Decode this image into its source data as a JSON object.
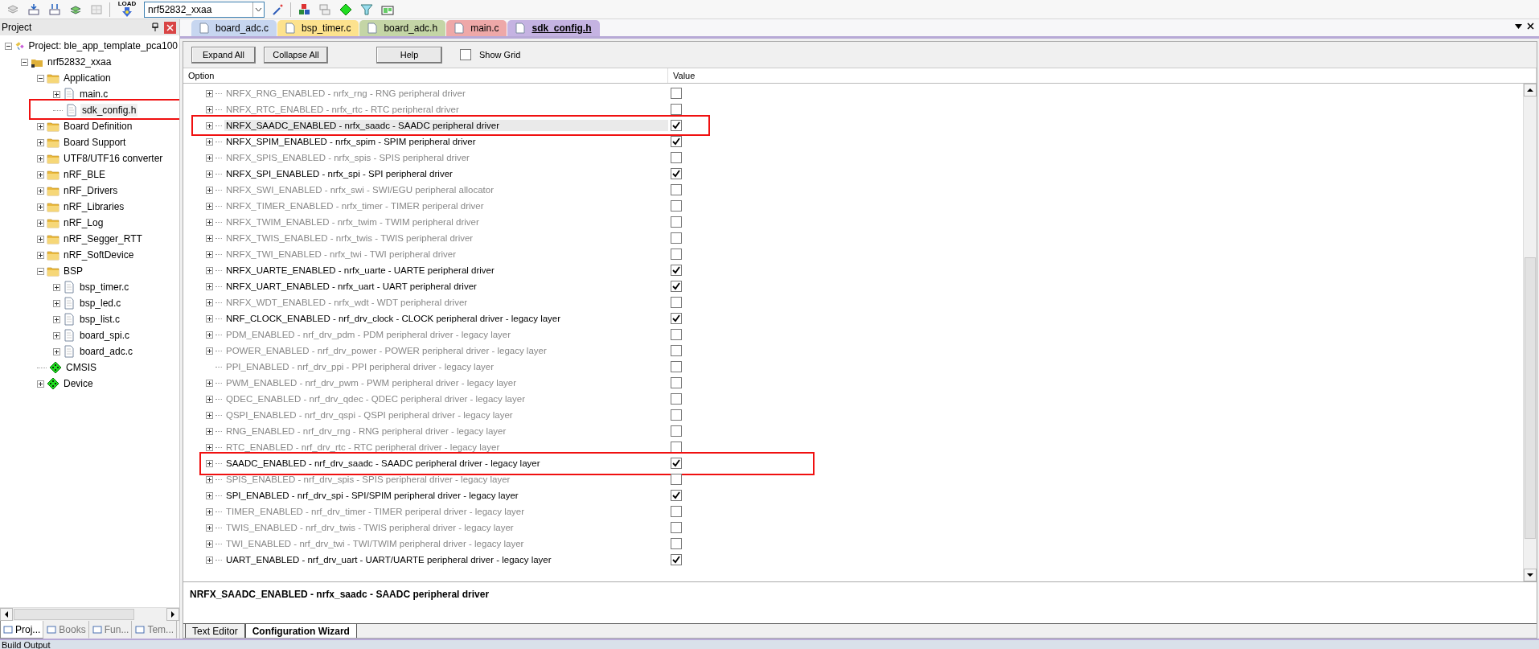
{
  "toolbar": {
    "load_label": "LOAD",
    "target": "nrf52832_xxaa"
  },
  "project_panel": {
    "title": "Project",
    "tree": [
      {
        "label": "Project: ble_app_template_pca100",
        "kind": "project",
        "expanded": true,
        "selected": false,
        "children": [
          {
            "label": "nrf52832_xxaa",
            "kind": "target",
            "expanded": true,
            "selected": false,
            "children": [
              {
                "label": "Application",
                "kind": "folder",
                "expanded": true,
                "selected": false,
                "children": [
                  {
                    "label": "main.c",
                    "kind": "file",
                    "expanded": false,
                    "selected": false
                  },
                  {
                    "label": "sdk_config.h",
                    "kind": "file",
                    "selected": true,
                    "highlighted": true
                  }
                ]
              },
              {
                "label": "Board Definition",
                "kind": "folder",
                "expanded": false,
                "selected": false
              },
              {
                "label": "Board Support",
                "kind": "folder",
                "expanded": false,
                "selected": false
              },
              {
                "label": "UTF8/UTF16 converter",
                "kind": "folder",
                "expanded": false,
                "selected": false
              },
              {
                "label": "nRF_BLE",
                "kind": "folder",
                "expanded": false,
                "selected": false
              },
              {
                "label": "nRF_Drivers",
                "kind": "folder",
                "expanded": false,
                "selected": false
              },
              {
                "label": "nRF_Libraries",
                "kind": "folder",
                "expanded": false,
                "selected": false
              },
              {
                "label": "nRF_Log",
                "kind": "folder",
                "expanded": false,
                "selected": false
              },
              {
                "label": "nRF_Segger_RTT",
                "kind": "folder",
                "expanded": false,
                "selected": false
              },
              {
                "label": "nRF_SoftDevice",
                "kind": "folder",
                "expanded": false,
                "selected": false
              },
              {
                "label": "BSP",
                "kind": "folder",
                "expanded": true,
                "selected": false,
                "children": [
                  {
                    "label": "bsp_timer.c",
                    "kind": "file",
                    "expanded": false,
                    "selected": false
                  },
                  {
                    "label": "bsp_led.c",
                    "kind": "file",
                    "expanded": false,
                    "selected": false
                  },
                  {
                    "label": "bsp_list.c",
                    "kind": "file",
                    "expanded": false,
                    "selected": false
                  },
                  {
                    "label": "board_spi.c",
                    "kind": "file",
                    "expanded": false,
                    "selected": false
                  },
                  {
                    "label": "board_adc.c",
                    "kind": "file",
                    "expanded": false,
                    "selected": false
                  }
                ]
              },
              {
                "label": "CMSIS",
                "kind": "component",
                "selected": false
              },
              {
                "label": "Device",
                "kind": "component",
                "expanded": false,
                "selected": false
              }
            ]
          }
        ]
      }
    ],
    "tabs": [
      {
        "label": "Proj...",
        "selected": true
      },
      {
        "label": "Books",
        "selected": false
      },
      {
        "label": "Fun...",
        "selected": false
      },
      {
        "label": "Tem...",
        "selected": false
      }
    ]
  },
  "editor_tabs": [
    {
      "label": "board_adc.c",
      "color": "#c7d6f0",
      "selected": false
    },
    {
      "label": "bsp_timer.c",
      "color": "#fde28e",
      "selected": false
    },
    {
      "label": "board_adc.h",
      "color": "#c4d5a6",
      "selected": false
    },
    {
      "label": "main.c",
      "color": "#eea8a8",
      "selected": false
    },
    {
      "label": "sdk_config.h",
      "color": "#c5b3e2",
      "selected": true
    }
  ],
  "wizard": {
    "buttons": [
      "Expand All",
      "Collapse All",
      "Help"
    ],
    "show_grid": {
      "label": "Show Grid",
      "checked": false
    },
    "columns": [
      "Option",
      "Value"
    ],
    "rows": [
      {
        "text": "NRFX_RNG_ENABLED - nrfx_rng - RNG peripheral driver",
        "expandable": true,
        "checked": false,
        "selected": false,
        "highlighted": false
      },
      {
        "text": "NRFX_RTC_ENABLED - nrfx_rtc - RTC peripheral driver",
        "expandable": true,
        "checked": false,
        "selected": false,
        "highlighted": false
      },
      {
        "text": "NRFX_SAADC_ENABLED - nrfx_saadc - SAADC peripheral driver",
        "expandable": true,
        "checked": true,
        "selected": true,
        "highlighted": true
      },
      {
        "text": "NRFX_SPIM_ENABLED - nrfx_spim - SPIM peripheral driver",
        "expandable": true,
        "checked": true,
        "selected": false,
        "highlighted": false
      },
      {
        "text": "NRFX_SPIS_ENABLED - nrfx_spis - SPIS peripheral driver",
        "expandable": true,
        "checked": false,
        "selected": false,
        "highlighted": false
      },
      {
        "text": "NRFX_SPI_ENABLED - nrfx_spi - SPI peripheral driver",
        "expandable": true,
        "checked": true,
        "selected": false,
        "highlighted": false
      },
      {
        "text": "NRFX_SWI_ENABLED - nrfx_swi - SWI/EGU peripheral allocator",
        "expandable": true,
        "checked": false,
        "selected": false,
        "highlighted": false
      },
      {
        "text": "NRFX_TIMER_ENABLED - nrfx_timer - TIMER periperal driver",
        "expandable": true,
        "checked": false,
        "selected": false,
        "highlighted": false
      },
      {
        "text": "NRFX_TWIM_ENABLED - nrfx_twim - TWIM peripheral driver",
        "expandable": true,
        "checked": false,
        "selected": false,
        "highlighted": false
      },
      {
        "text": "NRFX_TWIS_ENABLED - nrfx_twis - TWIS peripheral driver",
        "expandable": true,
        "checked": false,
        "selected": false,
        "highlighted": false
      },
      {
        "text": "NRFX_TWI_ENABLED - nrfx_twi - TWI peripheral driver",
        "expandable": true,
        "checked": false,
        "selected": false,
        "highlighted": false
      },
      {
        "text": "NRFX_UARTE_ENABLED - nrfx_uarte - UARTE peripheral driver",
        "expandable": true,
        "checked": true,
        "selected": false,
        "highlighted": false
      },
      {
        "text": "NRFX_UART_ENABLED - nrfx_uart - UART peripheral driver",
        "expandable": true,
        "checked": true,
        "selected": false,
        "highlighted": false
      },
      {
        "text": "NRFX_WDT_ENABLED - nrfx_wdt - WDT peripheral driver",
        "expandable": true,
        "checked": false,
        "selected": false,
        "highlighted": false
      },
      {
        "text": "NRF_CLOCK_ENABLED - nrf_drv_clock - CLOCK peripheral driver - legacy layer",
        "expandable": true,
        "checked": true,
        "selected": false,
        "highlighted": false
      },
      {
        "text": "PDM_ENABLED - nrf_drv_pdm - PDM peripheral driver - legacy layer",
        "expandable": true,
        "checked": false,
        "selected": false,
        "highlighted": false
      },
      {
        "text": "POWER_ENABLED - nrf_drv_power - POWER peripheral driver - legacy layer",
        "expandable": true,
        "checked": false,
        "selected": false,
        "highlighted": false
      },
      {
        "text": "PPI_ENABLED  - nrf_drv_ppi - PPI peripheral driver - legacy layer",
        "expandable": false,
        "checked": false,
        "selected": false,
        "highlighted": false
      },
      {
        "text": "PWM_ENABLED - nrf_drv_pwm - PWM peripheral driver - legacy layer",
        "expandable": true,
        "checked": false,
        "selected": false,
        "highlighted": false
      },
      {
        "text": "QDEC_ENABLED - nrf_drv_qdec - QDEC peripheral driver - legacy layer",
        "expandable": true,
        "checked": false,
        "selected": false,
        "highlighted": false
      },
      {
        "text": "QSPI_ENABLED - nrf_drv_qspi - QSPI peripheral driver - legacy layer",
        "expandable": true,
        "checked": false,
        "selected": false,
        "highlighted": false
      },
      {
        "text": "RNG_ENABLED - nrf_drv_rng - RNG peripheral driver - legacy layer",
        "expandable": true,
        "checked": false,
        "selected": false,
        "highlighted": false
      },
      {
        "text": "RTC_ENABLED - nrf_drv_rtc - RTC peripheral driver - legacy layer",
        "expandable": true,
        "checked": false,
        "selected": false,
        "highlighted": false
      },
      {
        "text": "SAADC_ENABLED - nrf_drv_saadc - SAADC peripheral driver - legacy layer",
        "expandable": true,
        "checked": true,
        "selected": false,
        "highlighted": true
      },
      {
        "text": "SPIS_ENABLED - nrf_drv_spis - SPIS peripheral driver - legacy layer",
        "expandable": true,
        "checked": false,
        "selected": false,
        "highlighted": false
      },
      {
        "text": "SPI_ENABLED - nrf_drv_spi - SPI/SPIM peripheral driver - legacy layer",
        "expandable": true,
        "checked": true,
        "selected": false,
        "highlighted": false
      },
      {
        "text": "TIMER_ENABLED - nrf_drv_timer - TIMER periperal driver - legacy layer",
        "expandable": true,
        "checked": false,
        "selected": false,
        "highlighted": false
      },
      {
        "text": "TWIS_ENABLED - nrf_drv_twis - TWIS peripheral driver - legacy layer",
        "expandable": true,
        "checked": false,
        "selected": false,
        "highlighted": false
      },
      {
        "text": "TWI_ENABLED - nrf_drv_twi - TWI/TWIM peripheral driver - legacy layer",
        "expandable": true,
        "checked": false,
        "selected": false,
        "highlighted": false
      },
      {
        "text": "UART_ENABLED - nrf_drv_uart - UART/UARTE peripheral driver - legacy layer",
        "expandable": true,
        "checked": true,
        "selected": false,
        "highlighted": false
      }
    ],
    "description": "NRFX_SAADC_ENABLED - nrfx_saadc - SAADC peripheral driver",
    "view_tabs": [
      {
        "label": "Text Editor",
        "selected": false
      },
      {
        "label": "Configuration Wizard",
        "selected": true
      }
    ]
  },
  "build_output": {
    "title": "Build Output"
  }
}
